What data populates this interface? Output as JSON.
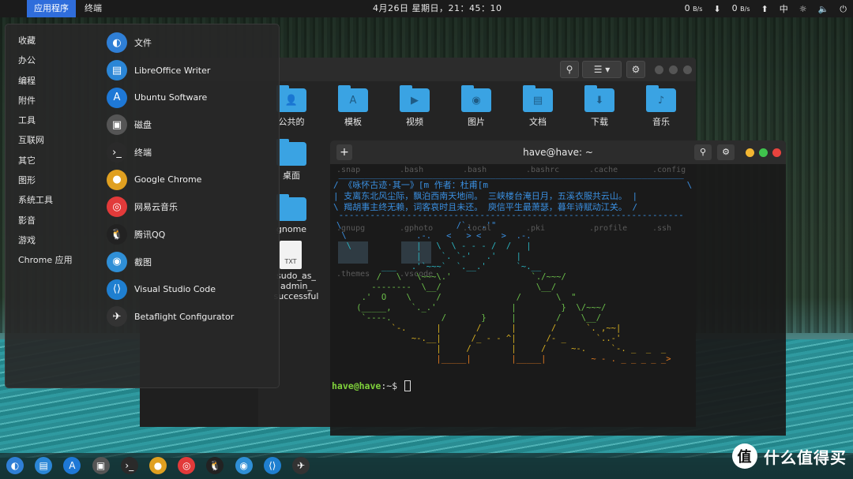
{
  "topbar": {
    "apple_icon": "apple-icon",
    "menu_active": "应用程序",
    "menu_terminal": "终端",
    "clock": "4月26日 星期日，21：45：10",
    "net_down": "0",
    "net_down_unit": "B/s",
    "net_up": "0",
    "net_up_unit": "B/s",
    "lang": "中"
  },
  "categories": [
    "收藏",
    "办公",
    "编程",
    "附件",
    "工具",
    "互联网",
    "其它",
    "图形",
    "系统工具",
    "影音",
    "游戏",
    "Chrome 应用"
  ],
  "apps": [
    {
      "label": "文件",
      "icon": "files-icon",
      "color": "#2f7fd6",
      "glyph": "◐"
    },
    {
      "label": "LibreOffice Writer",
      "icon": "writer-icon",
      "color": "#2b86d6",
      "glyph": "▤"
    },
    {
      "label": "Ubuntu Software",
      "icon": "software-icon",
      "color": "#1e78d6",
      "glyph": "A"
    },
    {
      "label": "磁盘",
      "icon": "disk-icon",
      "color": "#555",
      "glyph": "▣"
    },
    {
      "label": "终端",
      "icon": "terminal-icon",
      "color": "#2a2a2a",
      "glyph": "›_"
    },
    {
      "label": "Google Chrome",
      "icon": "chrome-icon",
      "color": "#e0a020",
      "glyph": "●"
    },
    {
      "label": "网易云音乐",
      "icon": "netease-music-icon",
      "color": "#e23a3a",
      "glyph": "◎"
    },
    {
      "label": "腾讯QQ",
      "icon": "qq-icon",
      "color": "#222",
      "glyph": "🐧"
    },
    {
      "label": "截图",
      "icon": "screenshot-icon",
      "color": "#2f8fd6",
      "glyph": "◉"
    },
    {
      "label": "Visual Studio Code",
      "icon": "vscode-icon",
      "color": "#1f7fd0",
      "glyph": "⟨⟩"
    },
    {
      "label": "Betaflight Configurator",
      "icon": "betaflight-icon",
      "color": "#333",
      "glyph": "✈"
    }
  ],
  "files": {
    "folders_row1": [
      "公共的",
      "模板",
      "视频",
      "图片",
      "文档",
      "下载",
      "音乐"
    ],
    "folders_row2": [
      "桌面"
    ],
    "gnome": "gnome",
    "sudo_file_ext": "TXT",
    "sudo_file": "sudo_as_\nadmin_\nsuccessful",
    "ghost_row1": [
      ".snap",
      ".bash",
      ".bash",
      ".bashrc",
      ".cache",
      ".config"
    ],
    "ghost_row2": [
      ".gnupg",
      ".gphoto",
      ".local",
      ".pki",
      ".profile",
      ".ssh"
    ],
    "ghost_row3": [
      ".themes",
      ".vscode"
    ]
  },
  "terminal": {
    "title": "have@have: ~",
    "poem_line1": "/ 《咏怀古迹·其一》[m 作者：杜甫[m                                      \\",
    "poem_line2": "| 支离东北风尘际，飘泊西南天地间。 三峡楼台淹日月，五溪衣服共云山。 |",
    "poem_line3": "\\ 羯胡事主终无赖，词客哀时且未还。 庾信平生最萧瑟，暮年诗赋动江关。 /",
    "prompt_user": "have@have",
    "prompt_path": ":~$ ",
    "colors": {
      "poem": "#3a8fe0",
      "user": "#7fd13b",
      "path": "#3a8fe0",
      "art1": "#3a8fe0",
      "art2": "#2bb3c0",
      "art3": "#6cc04a",
      "art4": "#d8b020",
      "art5": "#e07a20"
    }
  },
  "dock_icons": [
    "files-icon",
    "writer-icon",
    "software-icon",
    "disk-icon",
    "terminal-icon",
    "chrome-icon",
    "netease-music-icon",
    "qq-icon",
    "screenshot-icon",
    "vscode-icon",
    "betaflight-icon"
  ],
  "watermark": {
    "logo": "值",
    "text": "什么值得买"
  }
}
